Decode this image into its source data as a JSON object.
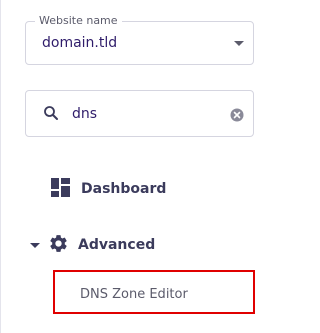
{
  "website_select": {
    "label": "Website name",
    "value": "domain.tld",
    "icon": "chevron-down-icon"
  },
  "search": {
    "value": "dns",
    "icon": "search-icon",
    "clear_icon": "close-circle-icon"
  },
  "nav": {
    "items": [
      {
        "label": "Dashboard",
        "icon": "dashboard-icon"
      },
      {
        "label": "Advanced",
        "icon": "gear-icon",
        "expanded": true,
        "children": [
          {
            "label": "DNS Zone Editor",
            "highlighted": true
          }
        ]
      }
    ]
  },
  "colors": {
    "text": "#2f1c6a",
    "nav_text": "#3b3b5c",
    "highlight_border": "#e00000",
    "border": "#d5d5e0"
  }
}
